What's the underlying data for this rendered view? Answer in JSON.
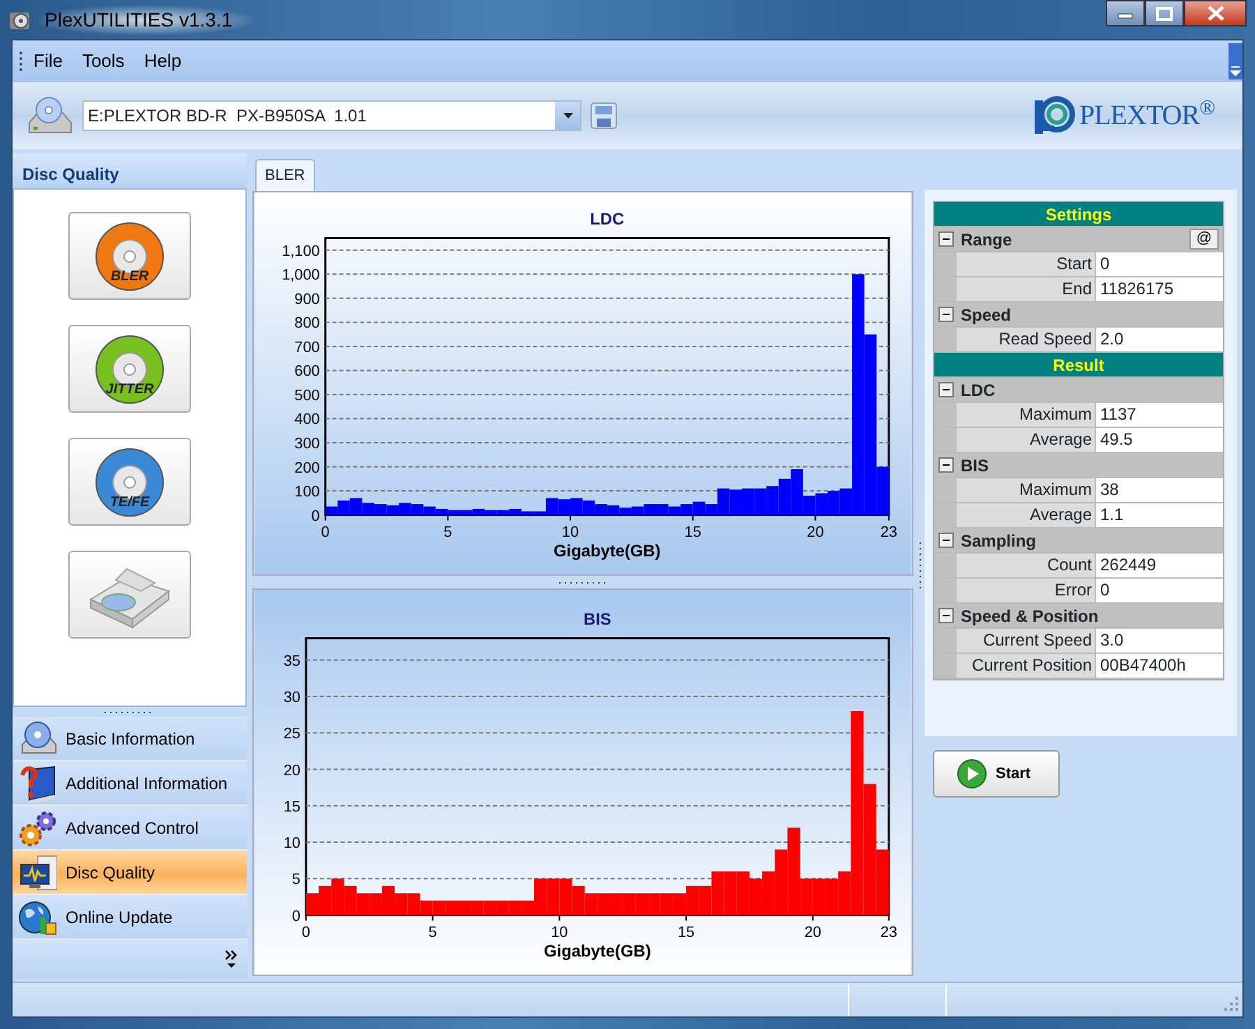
{
  "window": {
    "title": "PlexUTILITIES v1.3.1"
  },
  "menu": [
    "File",
    "Tools",
    "Help"
  ],
  "toolbar": {
    "drive": "E:PLEXTOR BD-R  PX-B950SA  1.01",
    "logo": "PLEXTOR$^{®}$"
  },
  "sidebar": {
    "header": "Disc Quality",
    "tools": [
      {
        "kind": "disc",
        "label": "BLER",
        "color": "#f07810"
      },
      {
        "kind": "disc",
        "label": "JITTER",
        "color": "#78c020"
      },
      {
        "kind": "disc",
        "label": "TE/FE",
        "color": "#3a8ad8"
      },
      {
        "kind": "drive"
      }
    ],
    "nav": [
      {
        "label": "Basic Information",
        "selected": false
      },
      {
        "label": "Additional Information",
        "selected": false
      },
      {
        "label": "Advanced Control",
        "selected": false
      },
      {
        "label": "Disc Quality",
        "selected": true
      },
      {
        "label": "Online Update",
        "selected": false
      }
    ]
  },
  "tabs": [
    {
      "label": "BLER",
      "selected": true
    }
  ],
  "charts": [
    {
      "chart_data": {
        "type": "bar",
        "grid": true,
        "title": "LDC",
        "xlabel": "Gigabyte(GB)",
        "xlim": [
          0,
          23
        ],
        "ylim": [
          0,
          1150
        ],
        "x": [
          0.25,
          0.75,
          1.25,
          1.75,
          2.25,
          2.75,
          3.25,
          3.75,
          4.25,
          4.75,
          5.25,
          5.75,
          6.25,
          6.75,
          7.25,
          7.75,
          8.25,
          8.75,
          9.25,
          9.75,
          10.25,
          10.75,
          11.25,
          11.75,
          12.25,
          12.75,
          13.25,
          13.75,
          14.25,
          14.75,
          15.25,
          15.75,
          16.25,
          16.75,
          17.25,
          17.75,
          18.25,
          18.75,
          19.25,
          19.75,
          20.25,
          20.75,
          21.25,
          21.75,
          22.25,
          22.75
        ],
        "series": [
          {
            "color": "#0000ff",
            "values": [
              35,
              60,
              70,
              50,
              45,
              40,
              50,
              45,
              35,
              25,
              20,
              20,
              25,
              20,
              20,
              25,
              15,
              15,
              70,
              65,
              70,
              60,
              45,
              40,
              30,
              35,
              45,
              45,
              35,
              45,
              55,
              45,
              110,
              105,
              110,
              110,
              120,
              150,
              190,
              80,
              90,
              100,
              110,
              1000,
              750,
              200
            ]
          }
        ],
        "xticks": [
          0,
          5,
          10,
          15,
          20,
          23
        ],
        "yticks": [
          0,
          100,
          200,
          300,
          400,
          500,
          600,
          700,
          800,
          900,
          {
            "value": 1000,
            "label": "1,000"
          },
          {
            "value": 1100,
            "label": "1,100"
          }
        ]
      }
    },
    {
      "chart_data": {
        "type": "bar",
        "grid": true,
        "title": "BIS",
        "xlabel": "Gigabyte(GB)",
        "xlim": [
          0,
          23
        ],
        "ylim": [
          0,
          38
        ],
        "x": [
          0.25,
          0.75,
          1.25,
          1.75,
          2.25,
          2.75,
          3.25,
          3.75,
          4.25,
          4.75,
          5.25,
          5.75,
          6.25,
          6.75,
          7.25,
          7.75,
          8.25,
          8.75,
          9.25,
          9.75,
          10.25,
          10.75,
          11.25,
          11.75,
          12.25,
          12.75,
          13.25,
          13.75,
          14.25,
          14.75,
          15.25,
          15.75,
          16.25,
          16.75,
          17.25,
          17.75,
          18.25,
          18.75,
          19.25,
          19.75,
          20.25,
          20.75,
          21.25,
          21.75,
          22.25,
          22.75
        ],
        "series": [
          {
            "color": "#ff0000",
            "values": [
              3,
              4,
              5,
              4,
              3,
              3,
              4,
              3,
              3,
              2,
              2,
              2,
              2,
              2,
              2,
              2,
              2,
              2,
              5,
              5,
              5,
              4,
              3,
              3,
              3,
              3,
              3,
              3,
              3,
              3,
              4,
              4,
              6,
              6,
              6,
              5,
              6,
              9,
              12,
              5,
              5,
              5,
              6,
              28,
              18,
              9
            ]
          }
        ],
        "xticks": [
          0,
          5,
          10,
          15,
          20,
          23
        ],
        "yticks": [
          0,
          5,
          10,
          15,
          20,
          25,
          30,
          35
        ]
      }
    }
  ],
  "properties": [
    {
      "title": "Settings",
      "groups": [
        {
          "name": "Range",
          "expanded": true,
          "button": "@",
          "rows": [
            {
              "label": "Start",
              "value": "0"
            },
            {
              "label": "End",
              "value": "11826175"
            }
          ]
        },
        {
          "name": "Speed",
          "expanded": true,
          "rows": [
            {
              "label": "Read Speed",
              "value": "2.0"
            }
          ]
        }
      ]
    },
    {
      "title": "Result",
      "groups": [
        {
          "name": "LDC",
          "expanded": true,
          "rows": [
            {
              "label": "Maximum",
              "value": "1137"
            },
            {
              "label": "Average",
              "value": "49.5"
            }
          ]
        },
        {
          "name": "BIS",
          "expanded": true,
          "rows": [
            {
              "label": "Maximum",
              "value": "38"
            },
            {
              "label": "Average",
              "value": "1.1"
            }
          ]
        },
        {
          "name": "Sampling",
          "expanded": true,
          "rows": [
            {
              "label": "Count",
              "value": "262449"
            },
            {
              "label": "Error",
              "value": "0"
            }
          ]
        },
        {
          "name": "Speed & Position",
          "expanded": true,
          "rows": [
            {
              "label": "Current Speed",
              "value": "3.0"
            },
            {
              "label": "Current Position",
              "value": "00B47400h"
            }
          ]
        }
      ]
    }
  ],
  "start_button": "Start"
}
